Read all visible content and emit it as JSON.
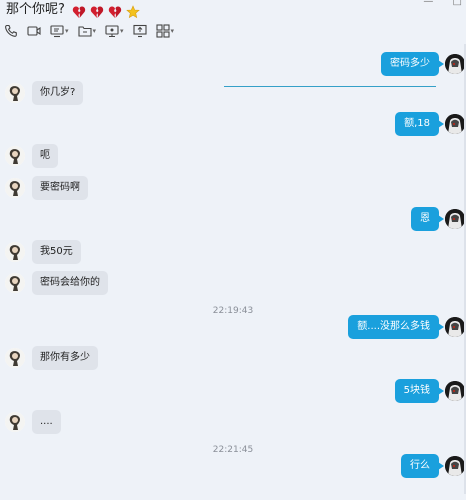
{
  "header": {
    "title": "那个你呢?",
    "toolbar": [
      "phone-icon",
      "video-icon",
      "screen-share-icon",
      "folder-icon",
      "remote-desktop-icon",
      "present-icon",
      "apps-icon"
    ]
  },
  "messages": [
    {
      "side": "right",
      "text": "密码多少"
    },
    {
      "side": "left",
      "text": "你几岁?"
    },
    {
      "side": "right",
      "text": "额,18"
    },
    {
      "side": "left",
      "text": "呃"
    },
    {
      "side": "left",
      "text": "要密码啊"
    },
    {
      "side": "right",
      "text": "恩"
    },
    {
      "side": "left",
      "text": "我50元"
    },
    {
      "side": "left",
      "text": "密码会给你的"
    },
    {
      "timestamp": "22:19:43"
    },
    {
      "side": "right",
      "text": "额....没那么多钱"
    },
    {
      "side": "left",
      "text": "那你有多少"
    },
    {
      "side": "right",
      "text": "5块钱"
    },
    {
      "side": "left",
      "text": "...."
    },
    {
      "timestamp": "22:21:45"
    },
    {
      "side": "right",
      "text": "行么"
    }
  ]
}
